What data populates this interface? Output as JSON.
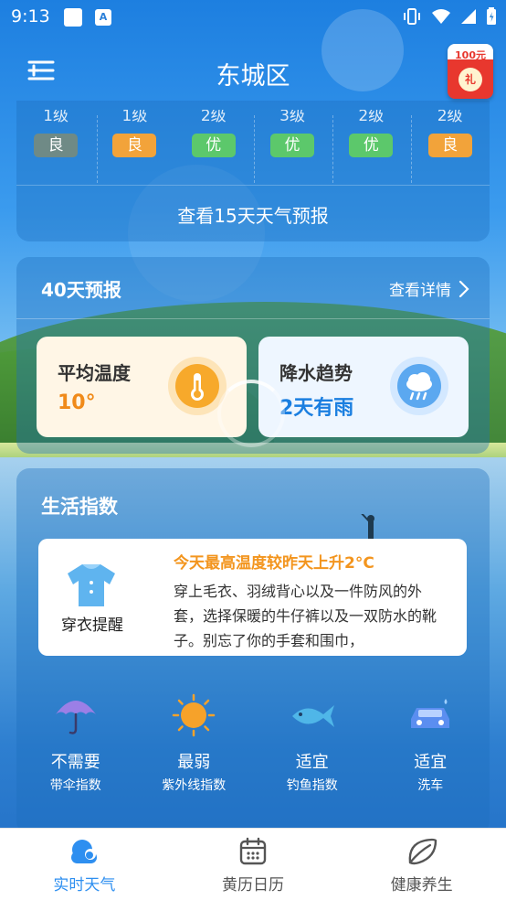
{
  "status_bar": {
    "time": "9:13",
    "app_icon_letter": "A"
  },
  "header": {
    "city": "东城区",
    "promo_amount": "100元",
    "promo_coin": "礼"
  },
  "aqi": [
    {
      "level": "1级",
      "quality": "良",
      "color": "#6f8a86"
    },
    {
      "level": "1级",
      "quality": "良",
      "color": "#f2a33a"
    },
    {
      "level": "2级",
      "quality": "优",
      "color": "#5cc86b"
    },
    {
      "level": "3级",
      "quality": "优",
      "color": "#5cc86b"
    },
    {
      "level": "2级",
      "quality": "优",
      "color": "#5cc86b"
    },
    {
      "level": "2级",
      "quality": "良",
      "color": "#f2a33a"
    }
  ],
  "forecast15_link": "查看15天天气预报",
  "forty_day": {
    "title": "40天预报",
    "detail": "查看详情",
    "avg_temp_label": "平均温度",
    "avg_temp_value": "10°",
    "precip_label": "降水趋势",
    "precip_value": "2天有雨"
  },
  "life": {
    "title": "生活指数",
    "clothing": {
      "label": "穿衣提醒",
      "headline": "今天最高温度较昨天上升2°C",
      "text": "穿上毛衣、羽绒背心以及一件防风的外套，选择保暖的牛仔裤以及一双防水的靴子。别忘了你的手套和围巾，"
    },
    "indices": [
      {
        "value": "不需要",
        "name": "带伞指数",
        "icon": "umbrella-icon"
      },
      {
        "value": "最弱",
        "name": "紫外线指数",
        "icon": "sun-icon"
      },
      {
        "value": "适宜",
        "name": "钓鱼指数",
        "icon": "fish-icon"
      },
      {
        "value": "适宜",
        "name": "洗车",
        "icon": "car-icon"
      }
    ]
  },
  "bottom_nav": [
    {
      "label": "实时天气",
      "icon": "weather-cloud-icon",
      "active": true
    },
    {
      "label": "黄历日历",
      "icon": "calendar-icon",
      "active": false
    },
    {
      "label": "健康养生",
      "icon": "leaf-icon",
      "active": false
    }
  ],
  "colors": {
    "accent": "#2e8ff0",
    "warm": "#f08a19",
    "rain": "#1b7fe0"
  }
}
